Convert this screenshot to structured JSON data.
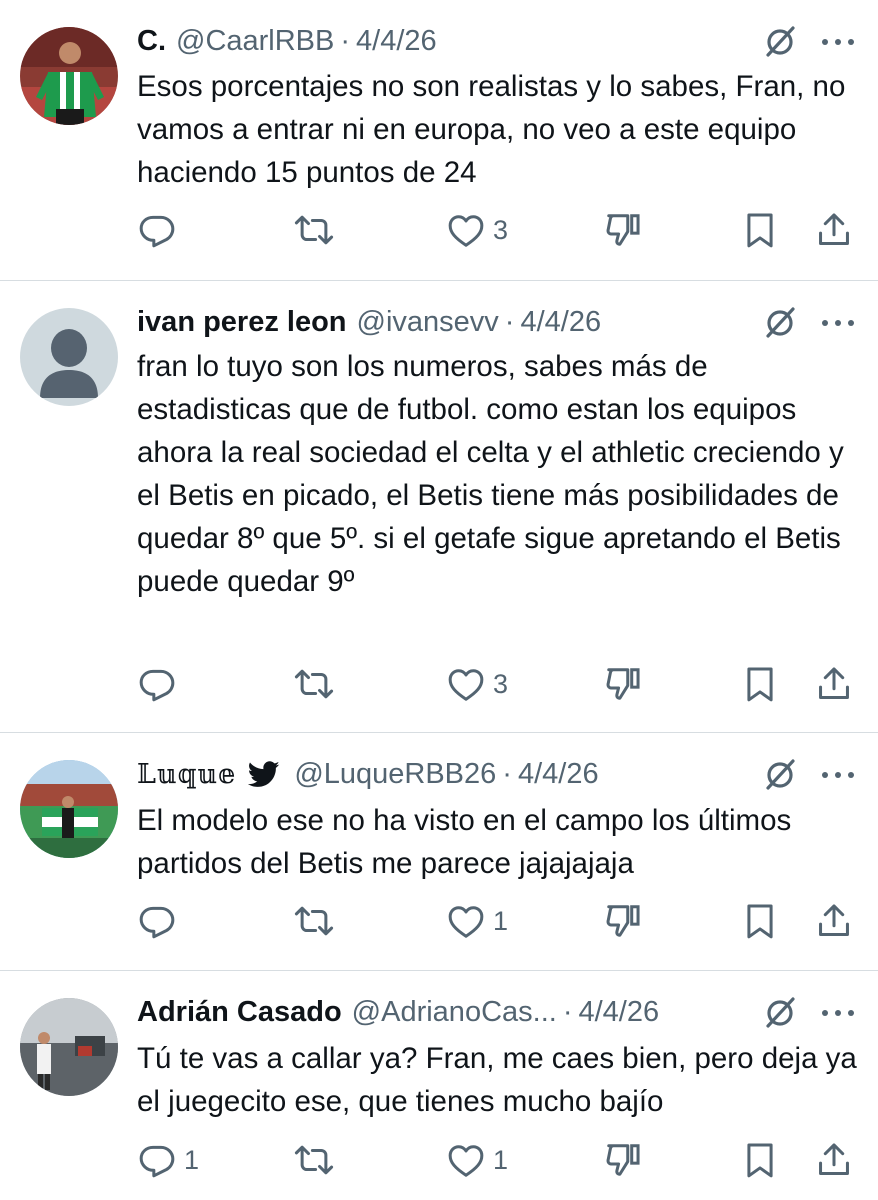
{
  "tweets": [
    {
      "name": "C.",
      "handle": "@CaarlRBB",
      "separator": "·",
      "date": "4/4/26",
      "text": "Esos porcentajes no son realistas y lo sabes, Fran, no vamos a entrar ni en europa, no veo a este equipo haciendo 15 puntos de 24",
      "replies": "",
      "retweets": "",
      "likes": "3"
    },
    {
      "name": "ivan perez leon",
      "handle": "@ivansevv",
      "separator": "·",
      "date": "4/4/26",
      "text": "fran lo tuyo son los numeros, sabes más de estadisticas que de futbol. como estan los equipos ahora la real sociedad el celta y el athletic creciendo y el Betis en picado, el Betis tiene más posibilidades de quedar 8º que 5º. si el getafe sigue apretando el Betis puede quedar 9º",
      "replies": "",
      "retweets": "",
      "likes": "3"
    },
    {
      "name": "𝕃𝕦𝕢𝕦𝕖",
      "handle": "@LuqueRBB26",
      "separator": "·",
      "date": "4/4/26",
      "text": "El modelo ese no ha visto en el campo los últimos partidos del Betis me parece jajajajaja",
      "replies": "",
      "retweets": "",
      "likes": "1"
    },
    {
      "name": "Adrián Casado",
      "handle": "@AdrianoCas...",
      "separator": "·",
      "date": "4/4/26",
      "text": "Tú te vas a callar ya? Fran, me caes bien, pero deja ya el juegecito ese, que tienes mucho bajío",
      "replies": "1",
      "retweets": "",
      "likes": "1"
    }
  ],
  "icons": {
    "reply": "reply-icon",
    "retweet": "retweet-icon",
    "like": "heart-icon",
    "dislike": "dislike-icon",
    "bookmark": "bookmark-icon",
    "share": "share-icon",
    "grok": "grok-icon",
    "more": "more-icon",
    "twitter_bird": "twitter-bird-icon"
  },
  "colors": {
    "text": "#0f1419",
    "secondary": "#536471",
    "divider": "#d7dde1",
    "twitter_blue": "#0f1419"
  }
}
